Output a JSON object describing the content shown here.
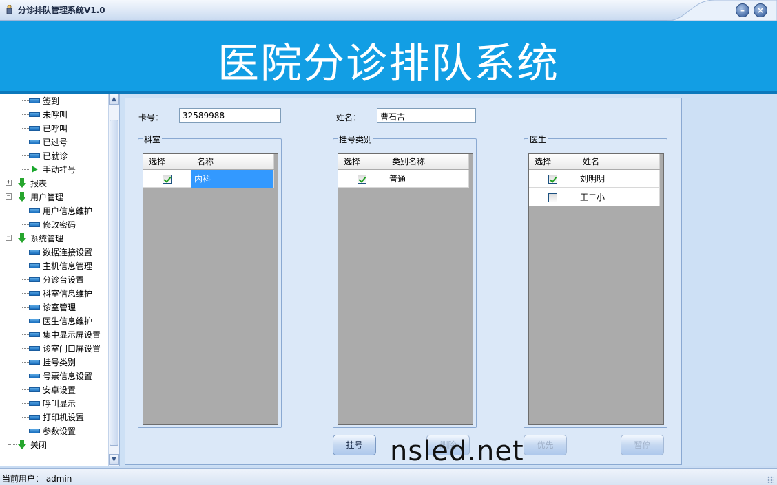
{
  "window": {
    "title": "分诊排队管理系统V1.0",
    "minimize_glyph": "–",
    "close_glyph": "×"
  },
  "banner": {
    "headline": "医院分诊排队系统"
  },
  "sidebar": {
    "items": [
      {
        "label": "签到",
        "type": "leaf",
        "level": 2
      },
      {
        "label": "未呼叫",
        "type": "leaf",
        "level": 2
      },
      {
        "label": "已呼叫",
        "type": "leaf",
        "level": 2
      },
      {
        "label": "已过号",
        "type": "leaf",
        "level": 2
      },
      {
        "label": "已就诊",
        "type": "leaf",
        "level": 2
      },
      {
        "label": "手动挂号",
        "type": "action",
        "level": 2
      },
      {
        "label": "报表",
        "type": "node",
        "level": 1,
        "expander": "+"
      },
      {
        "label": "用户管理",
        "type": "node",
        "level": 1,
        "expander": "−"
      },
      {
        "label": "用户信息维护",
        "type": "leaf",
        "level": 2
      },
      {
        "label": "修改密码",
        "type": "leaf",
        "level": 2
      },
      {
        "label": "系统管理",
        "type": "node",
        "level": 1,
        "expander": "−"
      },
      {
        "label": "数据连接设置",
        "type": "leaf",
        "level": 2
      },
      {
        "label": "主机信息管理",
        "type": "leaf",
        "level": 2
      },
      {
        "label": "分诊台设置",
        "type": "leaf",
        "level": 2
      },
      {
        "label": "科室信息维护",
        "type": "leaf",
        "level": 2
      },
      {
        "label": "诊室管理",
        "type": "leaf",
        "level": 2
      },
      {
        "label": "医生信息维护",
        "type": "leaf",
        "level": 2
      },
      {
        "label": "集中显示屏设置",
        "type": "leaf",
        "level": 2
      },
      {
        "label": "诊室门口屏设置",
        "type": "leaf",
        "level": 2
      },
      {
        "label": "挂号类别",
        "type": "leaf",
        "level": 2
      },
      {
        "label": "号票信息设置",
        "type": "leaf",
        "level": 2
      },
      {
        "label": "安卓设置",
        "type": "leaf",
        "level": 2
      },
      {
        "label": "呼叫显示",
        "type": "leaf",
        "level": 2
      },
      {
        "label": "打印机设置",
        "type": "leaf",
        "level": 2
      },
      {
        "label": "参数设置",
        "type": "leaf",
        "level": 2
      },
      {
        "label": "关闭",
        "type": "node",
        "level": 1,
        "expander": ""
      }
    ]
  },
  "form": {
    "card_label": "卡号：",
    "card_value": "32589988",
    "name_label": "姓名：",
    "name_value": "曹石吉"
  },
  "departments": {
    "title": "科室",
    "columns": [
      "选择",
      "名称"
    ],
    "rows": [
      {
        "checked": true,
        "name": "内科",
        "selected": true
      }
    ]
  },
  "categories": {
    "title": "挂号类别",
    "columns": [
      "选择",
      "类别名称"
    ],
    "rows": [
      {
        "checked": true,
        "name": "普通",
        "selected": false
      }
    ]
  },
  "doctors": {
    "title": "医生",
    "columns": [
      "选择",
      "姓名"
    ],
    "rows": [
      {
        "checked": true,
        "name": "刘明明",
        "selected": false
      },
      {
        "checked": false,
        "name": "王二小",
        "selected": false
      }
    ]
  },
  "buttons": {
    "register": "挂号",
    "delete": "删除",
    "priority": "优先",
    "pause": "暂停"
  },
  "watermark": "nsled.net",
  "status": {
    "text": "当前用户：  admin"
  },
  "colors": {
    "banner": "#129ee4",
    "selection": "#3399ff",
    "checkmark": "#21a121",
    "tree_arrow": "#27a62e"
  }
}
